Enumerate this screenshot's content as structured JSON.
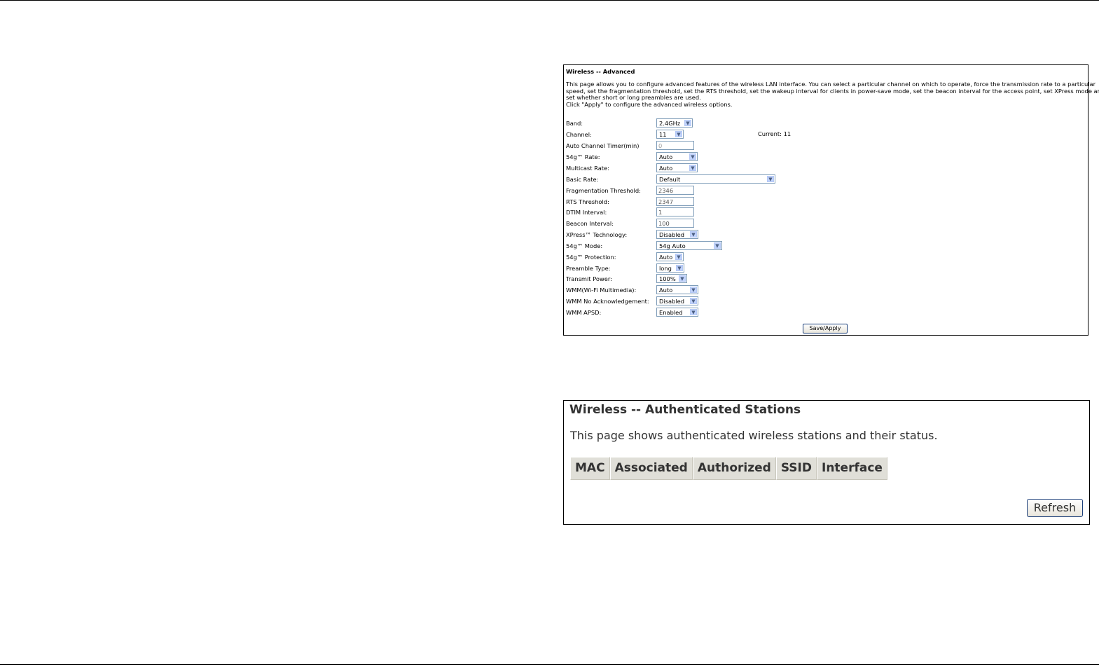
{
  "advanced": {
    "title": "Wireless -- Advanced",
    "description": [
      "This page allows you to configure advanced features of the wireless LAN interface. You can select a particular channel on which to operate, force the transmission rate to a particular",
      "speed, set the fragmentation threshold, set the RTS threshold, set the wakeup interval for clients in power-save mode, set the beacon interval for the access point, set XPress mode and",
      "set whether short or long preambles are used.",
      "Click \"Apply\" to configure the advanced wireless options."
    ],
    "fields": {
      "band": {
        "label": "Band:",
        "value": "2.4GHz"
      },
      "channel": {
        "label": "Channel:",
        "value": "11",
        "current": "Current: 11"
      },
      "auto_channel_timer": {
        "label": "Auto Channel Timer(min)",
        "value": "0"
      },
      "rate_54g": {
        "label": "54g™ Rate:",
        "value": "Auto"
      },
      "multicast_rate": {
        "label": "Multicast Rate:",
        "value": "Auto"
      },
      "basic_rate": {
        "label": "Basic Rate:",
        "value": "Default"
      },
      "frag_threshold": {
        "label": "Fragmentation Threshold:",
        "value": "2346"
      },
      "rts_threshold": {
        "label": "RTS Threshold:",
        "value": "2347"
      },
      "dtim_interval": {
        "label": "DTIM Interval:",
        "value": "1"
      },
      "beacon_interval": {
        "label": "Beacon Interval:",
        "value": "100"
      },
      "xpress": {
        "label": "XPress™ Technology:",
        "value": "Disabled"
      },
      "mode_54g": {
        "label": "54g™ Mode:",
        "value": "54g Auto"
      },
      "protection_54g": {
        "label": "54g™ Protection:",
        "value": "Auto"
      },
      "preamble": {
        "label": "Preamble Type:",
        "value": "long"
      },
      "tx_power": {
        "label": "Transmit Power:",
        "value": "100%"
      },
      "wmm": {
        "label": "WMM(Wi-Fi Multimedia):",
        "value": "Auto"
      },
      "wmm_noack": {
        "label": "WMM No Acknowledgement:",
        "value": "Disabled"
      },
      "wmm_apsd": {
        "label": "WMM APSD:",
        "value": "Enabled"
      }
    },
    "save_label": "Save/Apply"
  },
  "stations": {
    "title": "Wireless -- Authenticated Stations",
    "description": "This page shows authenticated wireless stations and their status.",
    "columns": [
      "MAC",
      "Associated",
      "Authorized",
      "SSID",
      "Interface"
    ],
    "refresh_label": "Refresh"
  },
  "icons": {
    "dropdown": "chevron-down-icon"
  }
}
